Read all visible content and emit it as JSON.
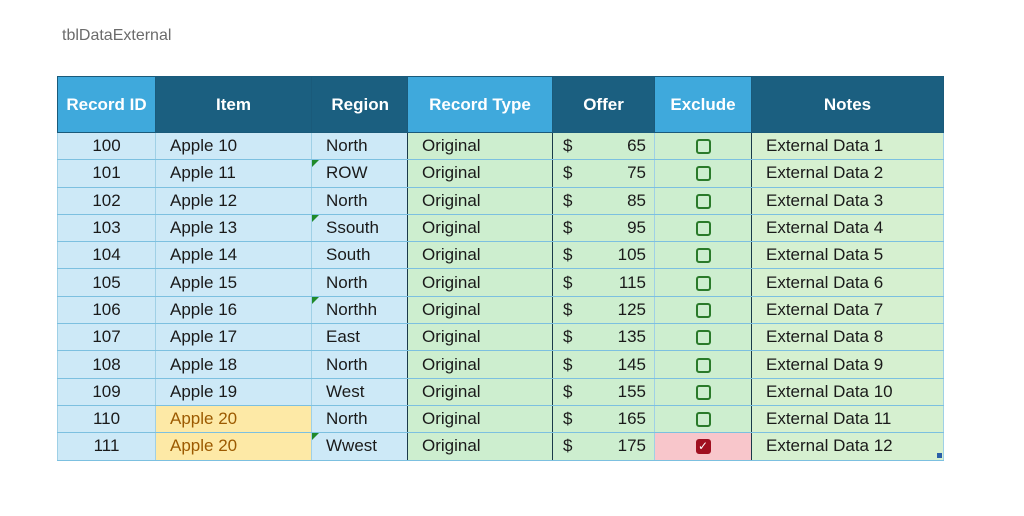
{
  "caption": "tblDataExternal",
  "columns": {
    "record_id": "Record ID",
    "item": "Item",
    "region": "Region",
    "record_type": "Record Type",
    "offer": "Offer",
    "exclude": "Exclude",
    "notes": "Notes"
  },
  "currency_symbol": "$",
  "rows": [
    {
      "id": "100",
      "item": "Apple 10",
      "region": "North",
      "type": "Original",
      "offer": "65",
      "exclude": false,
      "notes": "External Data 1"
    },
    {
      "id": "101",
      "item": "Apple 11",
      "region": "ROW",
      "type": "Original",
      "offer": "75",
      "exclude": false,
      "notes": "External Data 2"
    },
    {
      "id": "102",
      "item": "Apple 12",
      "region": "North",
      "type": "Original",
      "offer": "85",
      "exclude": false,
      "notes": "External Data 3"
    },
    {
      "id": "103",
      "item": "Apple 13",
      "region": "Ssouth",
      "type": "Original",
      "offer": "95",
      "exclude": false,
      "notes": "External Data 4"
    },
    {
      "id": "104",
      "item": "Apple 14",
      "region": "South",
      "type": "Original",
      "offer": "105",
      "exclude": false,
      "notes": "External Data 5"
    },
    {
      "id": "105",
      "item": "Apple 15",
      "region": "North",
      "type": "Original",
      "offer": "115",
      "exclude": false,
      "notes": "External Data 6"
    },
    {
      "id": "106",
      "item": "Apple 16",
      "region": "Northh",
      "type": "Original",
      "offer": "125",
      "exclude": false,
      "notes": "External Data 7"
    },
    {
      "id": "107",
      "item": "Apple 17",
      "region": "East",
      "type": "Original",
      "offer": "135",
      "exclude": false,
      "notes": "External Data 8"
    },
    {
      "id": "108",
      "item": "Apple 18",
      "region": "North",
      "type": "Original",
      "offer": "145",
      "exclude": false,
      "notes": "External Data 9"
    },
    {
      "id": "109",
      "item": "Apple 19",
      "region": "West",
      "type": "Original",
      "offer": "155",
      "exclude": false,
      "notes": "External Data 10"
    },
    {
      "id": "110",
      "item": "Apple 20",
      "region": "North",
      "type": "Original",
      "offer": "165",
      "exclude": false,
      "notes": "External Data 11"
    },
    {
      "id": "111",
      "item": "Apple 20",
      "region": "Wwest",
      "type": "Original",
      "offer": "175",
      "exclude": true,
      "notes": "External Data 12"
    }
  ],
  "flagged_regions": [
    "ROW",
    "Ssouth",
    "Northh",
    "Wwest"
  ],
  "duplicate_items": [
    "Apple 20"
  ],
  "colors": {
    "header_dark": "#1b5f80",
    "header_light": "#3fa9dc",
    "row_blue": "#cde9f7",
    "row_green": "#cdeecf",
    "duplicate_highlight": "#fde9a6",
    "exclude_highlight": "#f8c6cb",
    "notes_text": "#1f6fb5",
    "type_text": "#1e7a1e",
    "checkbox_checked": "#a01020"
  },
  "icons": {
    "unchecked": "checkbox-unchecked-icon",
    "checked": "checkbox-checked-icon",
    "flag": "error-flag-icon",
    "resize": "table-resize-handle-icon"
  }
}
